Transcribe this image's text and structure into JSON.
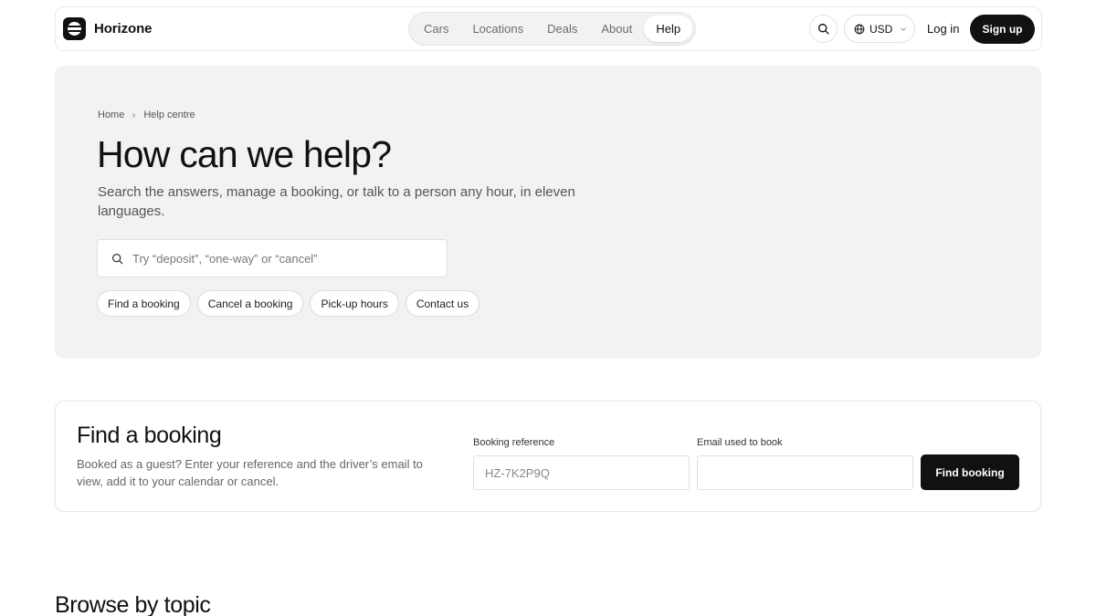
{
  "header": {
    "brand": "Horizone",
    "nav": [
      {
        "label": "Cars",
        "active": false
      },
      {
        "label": "Locations",
        "active": false
      },
      {
        "label": "Deals",
        "active": false
      },
      {
        "label": "About",
        "active": false
      },
      {
        "label": "Help",
        "active": true
      }
    ],
    "currency": "USD",
    "login_label": "Log in",
    "signup_label": "Sign up",
    "icons": {
      "search": "search-icon",
      "currency": "globe-icon",
      "currency_dropdown": "chevron-down-icon"
    }
  },
  "hero": {
    "breadcrumb": [
      "Home",
      "Help centre"
    ],
    "title": "How can we help?",
    "subtitle": "Search the answers, manage a booking, or talk to a person any hour, in eleven languages.",
    "search": {
      "placeholder": "Try “deposit”, “one-way” or “cancel”",
      "value": ""
    },
    "chips": [
      "Find a booking",
      "Cancel a booking",
      "Pick-up hours",
      "Contact us"
    ]
  },
  "find_booking": {
    "title": "Find a booking",
    "description": "Booked as a guest? Enter your reference and the driver’s email to view, add it to your calendar or cancel.",
    "reference_label": "Booking reference",
    "reference_placeholder": "HZ-7K2P9Q",
    "email_label": "Email used to book",
    "email_placeholder": "",
    "button_label": "Find booking"
  },
  "browse": {
    "title": "Browse by topic"
  },
  "colors": {
    "accent": "#111111",
    "hero_bg": "#f2f2f2",
    "border": "#e6e6e6",
    "muted_text": "#666666"
  }
}
